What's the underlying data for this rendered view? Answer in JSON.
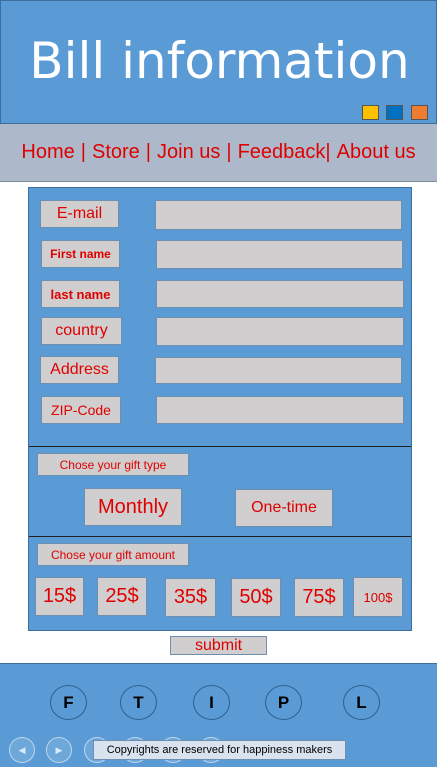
{
  "header": {
    "title": "Bill information",
    "swatches": [
      "#ffc000",
      "#0070c0",
      "#ed7d31"
    ]
  },
  "nav": {
    "items": [
      {
        "label": "Home"
      },
      {
        "label": "Store"
      },
      {
        "label": "Join us"
      },
      {
        "label": "Feedback"
      },
      {
        "label": "About us"
      }
    ],
    "separator": "|"
  },
  "form": {
    "fields": [
      {
        "label": "E-mail",
        "value": ""
      },
      {
        "label": "First name",
        "value": ""
      },
      {
        "label": "last name",
        "value": ""
      },
      {
        "label": "country",
        "value": ""
      },
      {
        "label": "Address",
        "value": ""
      },
      {
        "label": "ZIP-Code",
        "value": ""
      }
    ],
    "gift_type": {
      "label": "Chose your gift type",
      "options": [
        "Monthly",
        "One-time"
      ]
    },
    "gift_amount": {
      "label": "Chose your gift amount",
      "options": [
        "15$",
        "25$",
        "35$",
        "50$",
        "75$",
        "100$"
      ]
    },
    "submit_label": "submit"
  },
  "footer": {
    "social": [
      "F",
      "T",
      "I",
      "P",
      "L"
    ],
    "copyright": "Copyrights are reserved for happiness makers"
  },
  "colors": {
    "accent_blue": "#5b9bd5",
    "nav_bg": "#adb9ca",
    "text_red": "#e00000",
    "field_gray": "#d0cece"
  }
}
